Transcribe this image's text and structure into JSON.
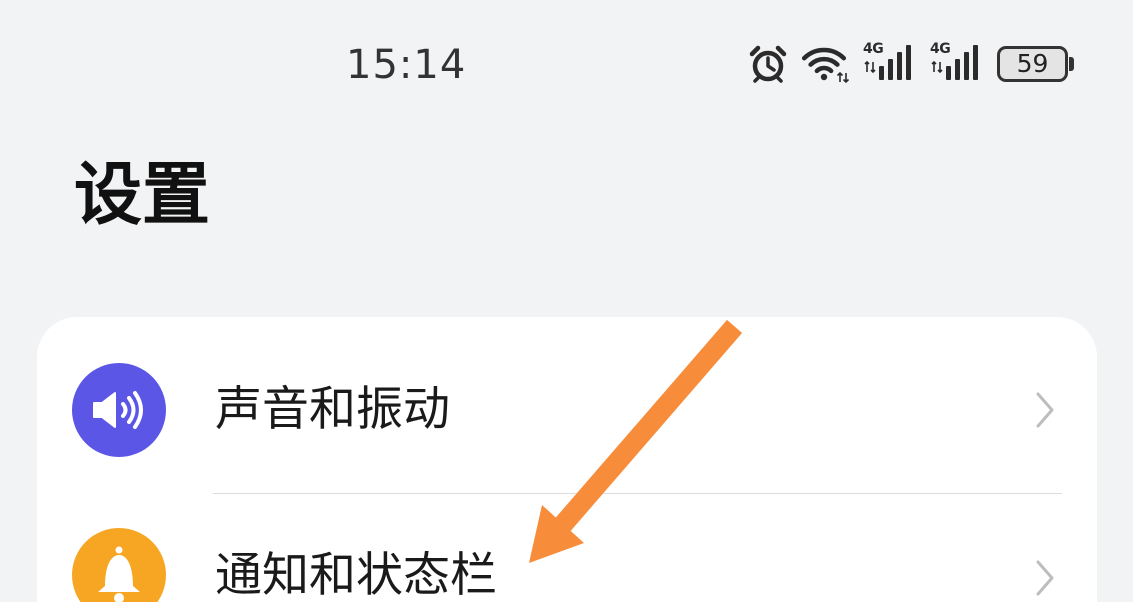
{
  "status_bar": {
    "time": "15:14",
    "icons": [
      "alarm-icon",
      "wifi-icon",
      "signal-icon",
      "signal-icon",
      "battery-icon"
    ],
    "signal_1_label": "4G",
    "signal_2_label": "4G",
    "battery_level": "59"
  },
  "header": {
    "title": "设置"
  },
  "settings_list": {
    "items": [
      {
        "label": "声音和振动",
        "icon": "speaker-icon",
        "icon_color": "#5b56e6"
      },
      {
        "label": "通知和状态栏",
        "icon": "bell-icon",
        "icon_color": "#f6a623"
      }
    ]
  },
  "annotation": {
    "icon": "arrow-icon",
    "color": "#f78d3a"
  },
  "colors": {
    "background": "#f1f3f5",
    "card": "#ffffff",
    "text": "#1a1a1a",
    "chevron": "#bdbdbd",
    "divider": "#dcdcdc"
  }
}
